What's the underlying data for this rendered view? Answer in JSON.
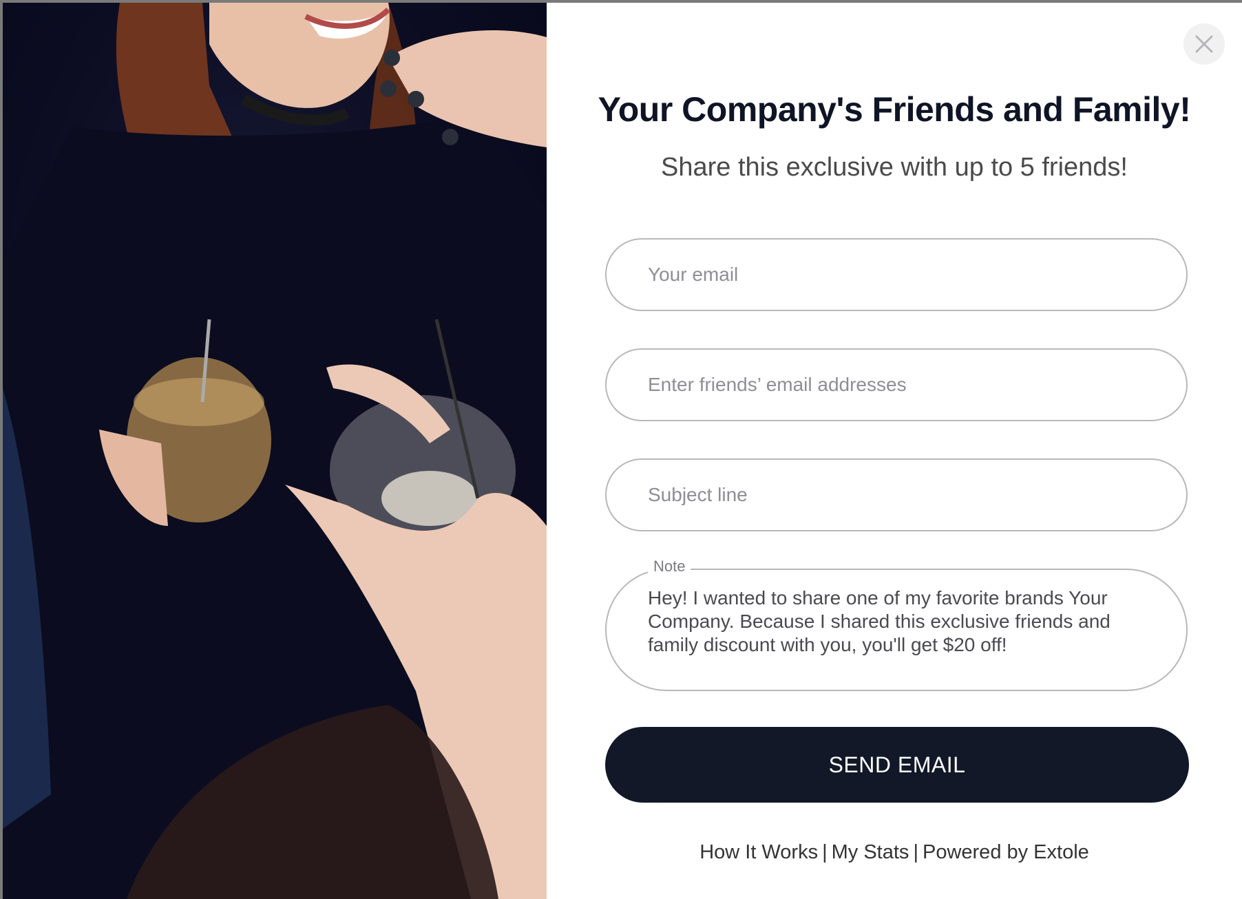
{
  "modal": {
    "title": "Your Company's Friends and Family!",
    "subtitle": "Share this exclusive with up to 5 friends!",
    "close_icon": "close-icon"
  },
  "form": {
    "your_email_placeholder": "Your email",
    "friends_email_placeholder": "Enter friends’ email addresses",
    "subject_placeholder": "Subject line",
    "note_label": "Note",
    "note_value": "Hey! I wanted to share one of my favorite brands Your Company. Because I shared this exclusive friends and family discount with you, you'll get $20 off!",
    "send_label": "SEND EMAIL"
  },
  "footer": {
    "how_it_works": "How It Works",
    "my_stats": "My Stats",
    "powered_by": "Powered by Extole",
    "separator": "|"
  },
  "colors": {
    "button_bg": "#121828",
    "title": "#0f1426",
    "border": "#b8b8bc"
  }
}
